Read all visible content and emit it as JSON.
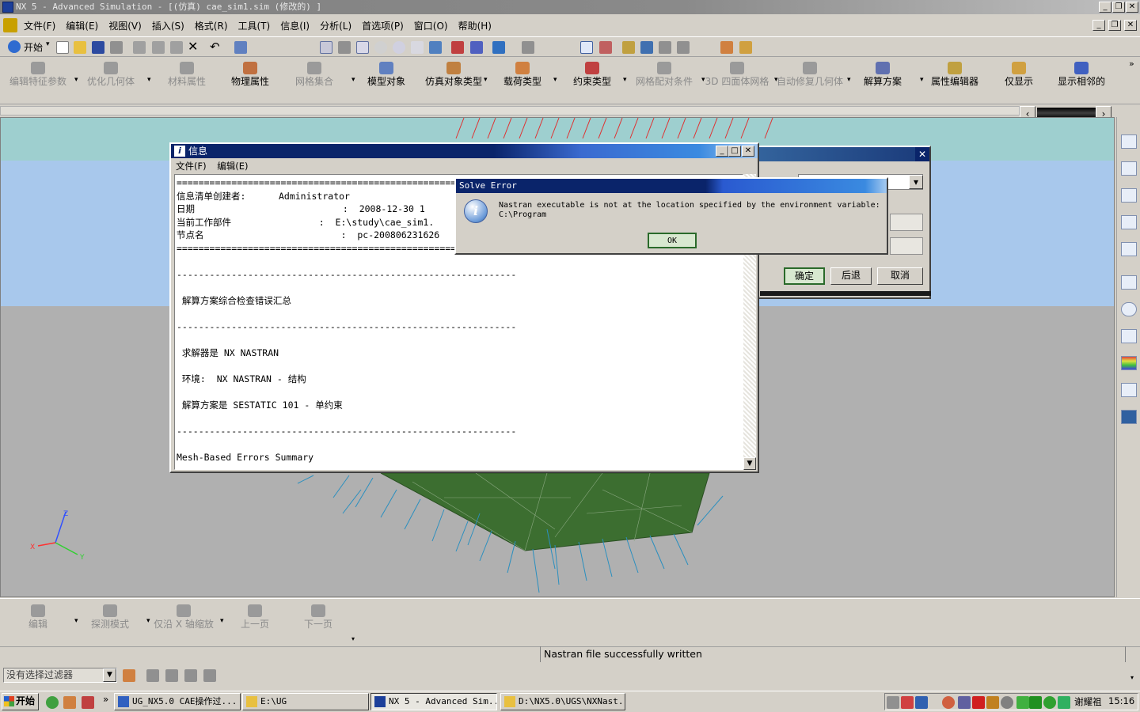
{
  "window": {
    "title": "NX 5 - Advanced Simulation - [(仿真) cae_sim1.sim (修改的) ]"
  },
  "menu": [
    "文件(F)",
    "编辑(E)",
    "视图(V)",
    "插入(S)",
    "格式(R)",
    "工具(T)",
    "信息(I)",
    "分析(L)",
    "首选项(P)",
    "窗口(O)",
    "帮助(H)"
  ],
  "toolbar": {
    "start_label": "开始"
  },
  "ribbon": [
    {
      "label": "编辑特征参数",
      "disabled": true
    },
    {
      "label": "优化几何体",
      "disabled": true
    },
    {
      "label": "材料属性",
      "disabled": true
    },
    {
      "label": "物理属性",
      "disabled": false
    },
    {
      "label": "网格集合",
      "disabled": true
    },
    {
      "label": "模型对象",
      "disabled": false
    },
    {
      "label": "仿真对象类型",
      "disabled": false
    },
    {
      "label": "载荷类型",
      "disabled": false
    },
    {
      "label": "约束类型",
      "disabled": false
    },
    {
      "label": "网格配对条件",
      "disabled": true
    },
    {
      "label": "3D 四面体网格",
      "disabled": true
    },
    {
      "label": "自动修复几何体",
      "disabled": true
    },
    {
      "label": "解算方案",
      "disabled": false
    },
    {
      "label": "属性编辑器",
      "disabled": false
    },
    {
      "label": "仅显示",
      "disabled": false
    },
    {
      "label": "显示相邻的",
      "disabled": false
    }
  ],
  "info_window": {
    "title": "信息",
    "menu": [
      "文件(F)",
      "编辑(E)"
    ],
    "lines": [
      "===========================================================",
      "信息清单创建者:      Administrator",
      "日期                           :  2008-12-30 1",
      "当前工作部件                :  E:\\study\\cae_sim1.",
      "节点名                         :  pc-200806231626",
      "===========================================================",
      "",
      "--------------------------------------------------------------",
      "",
      " 解算方案综合检查错误汇总",
      "",
      "--------------------------------------------------------------",
      "",
      " 求解器是 NX NASTRAN",
      "",
      " 环境:  NX NASTRAN - 结构",
      "",
      " 解算方案是 SESTATIC 101 - 单约束",
      "",
      "--------------------------------------------------------------",
      "",
      "Mesh-Based Errors Summary",
      "------------------------"
    ]
  },
  "error_dialog": {
    "title": "Solve Error",
    "message": "Nastran executable is not at the location specified by the environment variable: C:\\Program",
    "ok_label": "OK"
  },
  "solve_dialog": {
    "confirm_label": "确定",
    "back_label": "后退",
    "cancel_label": "取消"
  },
  "bottom_toolbar": [
    {
      "label": "编辑"
    },
    {
      "label": "探测模式"
    },
    {
      "label": "仅沿 X 轴缩放"
    },
    {
      "label": "上一页"
    },
    {
      "label": "下一页"
    }
  ],
  "status": {
    "message": "Nastran file successfully written"
  },
  "filter": {
    "value": "没有选择过滤器"
  },
  "axes": {
    "x": "X",
    "y": "Y",
    "z": "Z"
  },
  "taskbar": {
    "start_label": "开始",
    "items": [
      {
        "label": "UG_NX5.0 CAE操作过...",
        "active": false
      },
      {
        "label": "E:\\UG",
        "active": false
      },
      {
        "label": "NX 5 - Advanced Sim...",
        "active": true
      },
      {
        "label": "D:\\NX5.0\\UGS\\NXNast...",
        "active": false
      }
    ],
    "user": "谢耀祖",
    "clock": "15:16"
  },
  "colors": {
    "accent": "#0a246a",
    "viewport_top": "#9ecfcf",
    "viewport_mid": "#a8c8ec",
    "viewport_bottom": "#b0b0b0",
    "mesh": "#3c6e30",
    "arrows": "#2a8fbf"
  }
}
